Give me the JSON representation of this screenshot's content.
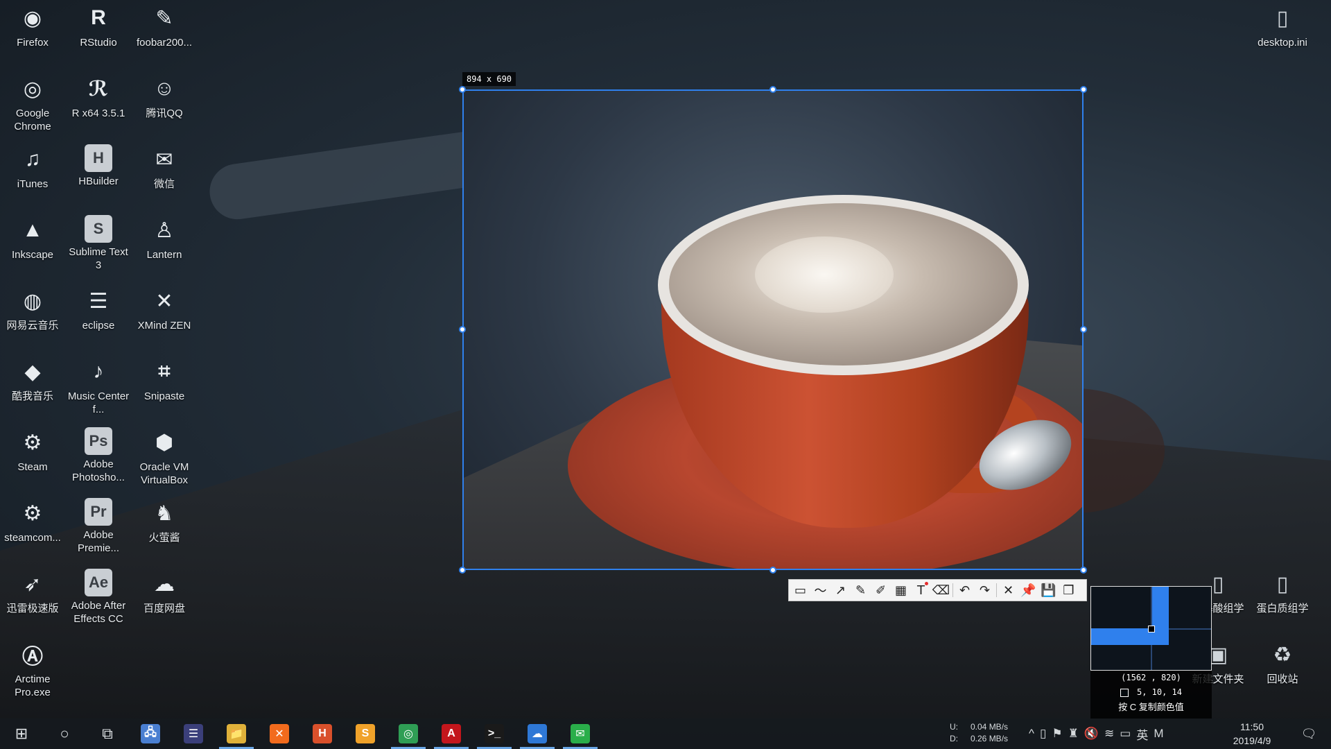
{
  "desktop_icons": [
    {
      "label": "Firefox",
      "icon": "firefox-icon",
      "glyph": "◉"
    },
    {
      "label": "RStudio",
      "icon": "rstudio-icon",
      "glyph": "R"
    },
    {
      "label": "foobar200...",
      "icon": "foobar-icon",
      "glyph": "✎"
    },
    {
      "label": "Google Chrome",
      "icon": "chrome-icon",
      "glyph": "◎"
    },
    {
      "label": "R x64 3.5.1",
      "icon": "r-icon",
      "glyph": "ℛ"
    },
    {
      "label": "腾讯QQ",
      "icon": "qq-icon",
      "glyph": "☺"
    },
    {
      "label": "iTunes",
      "icon": "itunes-icon",
      "glyph": "♫"
    },
    {
      "label": "HBuilder",
      "icon": "hbuilder-icon",
      "glyph": "H"
    },
    {
      "label": "微信",
      "icon": "wechat-icon",
      "glyph": "✉"
    },
    {
      "label": "Inkscape",
      "icon": "inkscape-icon",
      "glyph": "▲"
    },
    {
      "label": "Sublime Text 3",
      "icon": "sublime-icon",
      "glyph": "S"
    },
    {
      "label": "Lantern",
      "icon": "lantern-icon",
      "glyph": "♙"
    },
    {
      "label": "网易云音乐",
      "icon": "netease-music-icon",
      "glyph": "◍"
    },
    {
      "label": "eclipse",
      "icon": "eclipse-icon",
      "glyph": "☰"
    },
    {
      "label": "XMind ZEN",
      "icon": "xmind-icon",
      "glyph": "✕"
    },
    {
      "label": "酷我音乐",
      "icon": "kuwo-music-icon",
      "glyph": "◆"
    },
    {
      "label": "Music Center f...",
      "icon": "music-center-icon",
      "glyph": "♪"
    },
    {
      "label": "Snipaste",
      "icon": "snipaste-icon",
      "glyph": "⌗"
    },
    {
      "label": "Steam",
      "icon": "steam-icon",
      "glyph": "⚙"
    },
    {
      "label": "Adobe Photosho...",
      "icon": "photoshop-icon",
      "glyph": "Ps"
    },
    {
      "label": "Oracle VM VirtualBox",
      "icon": "virtualbox-icon",
      "glyph": "⬢"
    },
    {
      "label": "steamcom...",
      "icon": "steamcmd-icon",
      "glyph": "⚙"
    },
    {
      "label": "Adobe Premie...",
      "icon": "premiere-icon",
      "glyph": "Pr"
    },
    {
      "label": "火萤酱",
      "icon": "huoying-icon",
      "glyph": "♞"
    },
    {
      "label": "迅雷极速版",
      "icon": "thunder-icon",
      "glyph": "➶"
    },
    {
      "label": "Adobe After Effects CC",
      "icon": "after-effects-icon",
      "glyph": "Ae"
    },
    {
      "label": "百度网盘",
      "icon": "baidu-pan-icon",
      "glyph": "☁"
    },
    {
      "label": "Arctime Pro.exe",
      "icon": "arctime-icon",
      "glyph": "Ⓐ"
    }
  ],
  "right_icons": [
    {
      "label": "desktop.ini",
      "icon": "file-icon"
    },
    {
      "label": "氨基酸组学",
      "icon": "file-icon"
    },
    {
      "label": "蛋白质组学",
      "icon": "file-icon"
    },
    {
      "label": "新建文件夹",
      "icon": "folder-icon"
    },
    {
      "label": "回收站",
      "icon": "recycle-bin-icon"
    }
  ],
  "capture": {
    "size_label": "894 x 690"
  },
  "toolbar": {
    "tools": [
      {
        "name": "rectangle-tool",
        "glyph": "▭"
      },
      {
        "name": "polyline-tool",
        "glyph": "〜"
      },
      {
        "name": "arrow-tool",
        "glyph": "↗"
      },
      {
        "name": "pencil-tool",
        "glyph": "✎"
      },
      {
        "name": "marker-tool",
        "glyph": "✐"
      },
      {
        "name": "mosaic-tool",
        "glyph": "▦"
      },
      {
        "name": "text-tool",
        "glyph": "T"
      },
      {
        "name": "eraser-tool",
        "glyph": "⌫"
      },
      {
        "name": "undo-button",
        "glyph": "↶"
      },
      {
        "name": "redo-button",
        "glyph": "↷"
      },
      {
        "name": "cancel-button",
        "glyph": "✕"
      },
      {
        "name": "pin-button",
        "glyph": "📌"
      },
      {
        "name": "save-button",
        "glyph": "💾"
      },
      {
        "name": "copy-button",
        "glyph": "❐"
      }
    ]
  },
  "magnifier": {
    "coords": "(1562 , 820)",
    "rgb": "5,  10,  14",
    "hint": "按 C 复制颜色值"
  },
  "taskbar": {
    "apps": [
      {
        "name": "start-button",
        "glyph": "⊞",
        "color": ""
      },
      {
        "name": "search-button",
        "glyph": "○",
        "color": ""
      },
      {
        "name": "task-view-button",
        "glyph": "⧉",
        "color": ""
      },
      {
        "name": "taskbar-app-network",
        "glyph": "🖧",
        "color": "#4a7fd1"
      },
      {
        "name": "taskbar-app-eclipse",
        "glyph": "☰",
        "color": "#3b3f7a"
      },
      {
        "name": "taskbar-app-explorer",
        "glyph": "📁",
        "color": "#e0b13a"
      },
      {
        "name": "taskbar-app-xampp",
        "glyph": "✕",
        "color": "#f26b1d"
      },
      {
        "name": "taskbar-app-hbuilder",
        "glyph": "H",
        "color": "#d9502b"
      },
      {
        "name": "taskbar-app-sublime",
        "glyph": "S",
        "color": "#f0a22a"
      },
      {
        "name": "taskbar-app-chrome",
        "glyph": "◎",
        "color": "#2f9e55"
      },
      {
        "name": "taskbar-app-acrobat",
        "glyph": "A",
        "color": "#c3161c"
      },
      {
        "name": "taskbar-app-terminal",
        "glyph": ">_",
        "color": "#1a1a1a"
      },
      {
        "name": "taskbar-app-baidu",
        "glyph": "☁",
        "color": "#2e78d6"
      },
      {
        "name": "taskbar-app-wechat",
        "glyph": "✉",
        "color": "#2aae4a"
      }
    ],
    "net_up_label": "U:",
    "net_up": "0.04 MB/s",
    "net_down_label": "D:",
    "net_down": "0.26 MB/s",
    "tray": [
      "^",
      "▯",
      "⚑",
      "♜",
      "🔇",
      "≋",
      "▭",
      "英",
      "M"
    ],
    "time": "11:50",
    "date": "2019/4/9"
  },
  "colors": {
    "selection": "#2f80ed",
    "taskbar_accent": "#6aa6e6"
  }
}
